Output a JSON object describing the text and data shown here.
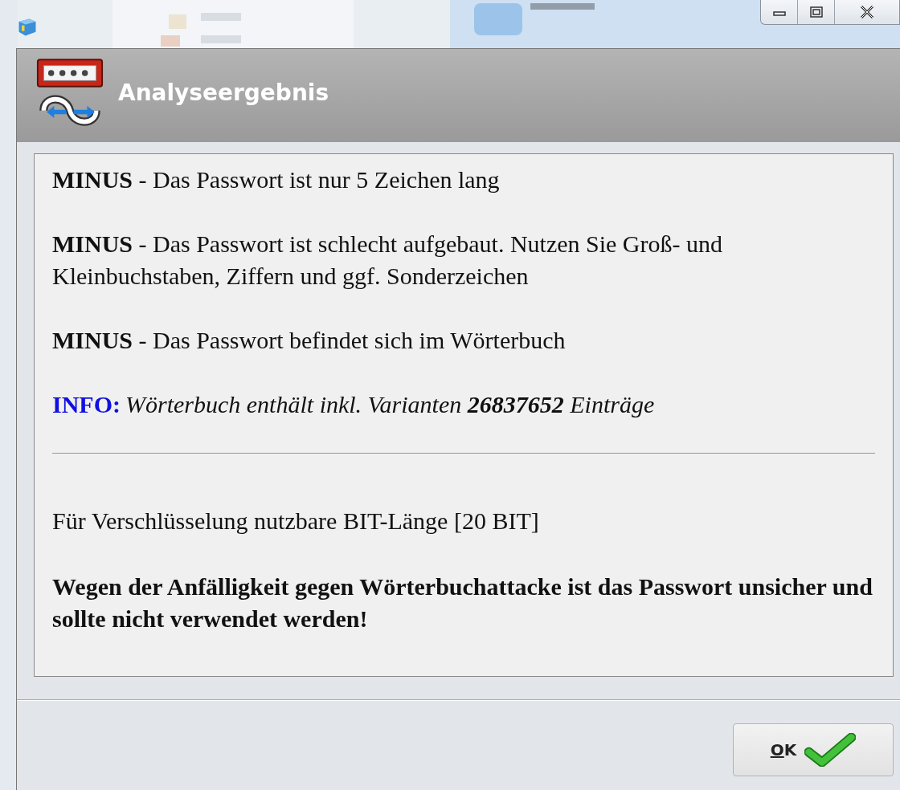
{
  "dialog": {
    "title": "Analyseergebnis"
  },
  "messages": [
    {
      "kind": "minus",
      "text": "**MINUS** - Das Passwort ist nur 5 Zeichen lang"
    },
    {
      "kind": "minus",
      "text": "**MINUS** - Das Passwort ist schlecht aufgebaut. Nutzen Sie Groß- und Kleinbuchstaben, Ziffern und ggf. Sonderzeichen"
    },
    {
      "kind": "minus",
      "text": "**MINUS** - Das Passwort befindet sich im Wörterbuch"
    },
    {
      "kind": "info",
      "label": "INFO:",
      "text": "Wörterbuch enthält inkl. Varianten **26837652** Einträge"
    }
  ],
  "bit_length": "Für Verschlüsselung nutzbare BIT-Länge [20 BIT]",
  "verdict": "Wegen der Anfälligkeit gegen Wörterbuchattacke ist das Passwort unsicher und sollte nicht verwendet werden!",
  "ok_button": {
    "label": "OK"
  }
}
